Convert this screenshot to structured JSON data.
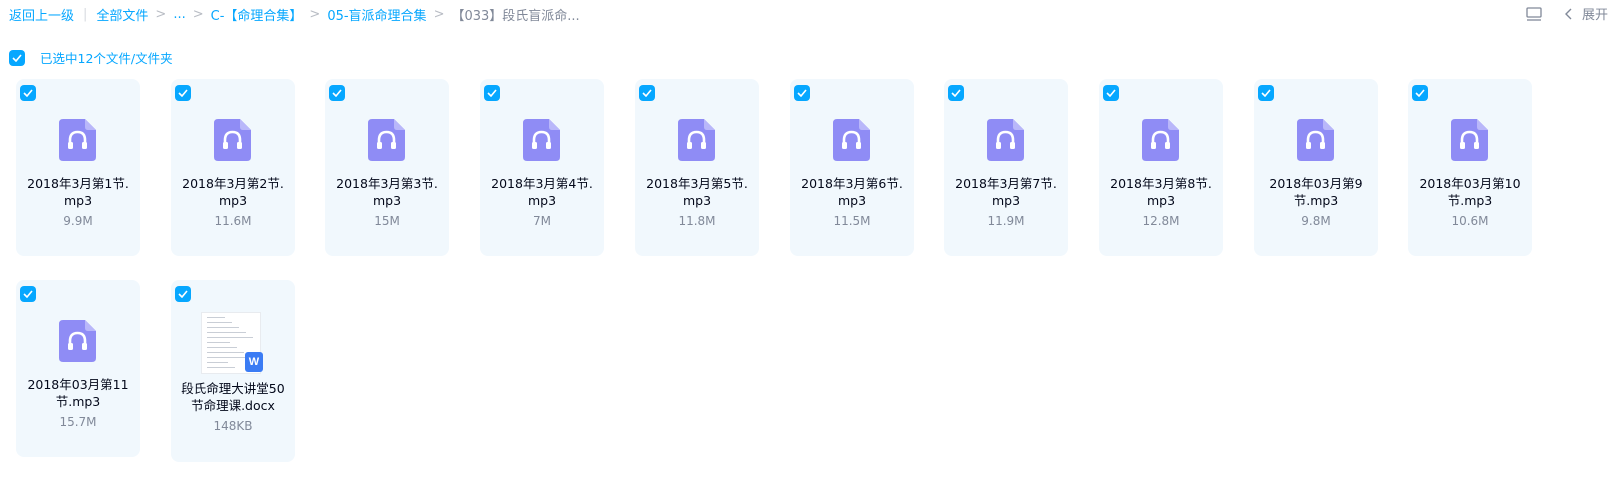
{
  "breadcrumb": {
    "back": "返回上一级",
    "all_files": "全部文件",
    "ellipsis": "...",
    "level1": "C-【命理合集】",
    "level2": "05-盲派命理合集",
    "current": "【033】段氏盲派命..."
  },
  "toolbar": {
    "expand_label": "展开"
  },
  "selection": {
    "label": "已选中12个文件/文件夹",
    "checked": true
  },
  "files": [
    {
      "name": "2018年3月第1节.mp3",
      "size": "9.9M",
      "type": "audio",
      "checked": true
    },
    {
      "name": "2018年3月第2节.mp3",
      "size": "11.6M",
      "type": "audio",
      "checked": true
    },
    {
      "name": "2018年3月第3节.mp3",
      "size": "15M",
      "type": "audio",
      "checked": true
    },
    {
      "name": "2018年3月第4节.mp3",
      "size": "7M",
      "type": "audio",
      "checked": true
    },
    {
      "name": "2018年3月第5节.mp3",
      "size": "11.8M",
      "type": "audio",
      "checked": true
    },
    {
      "name": "2018年3月第6节.mp3",
      "size": "11.5M",
      "type": "audio",
      "checked": true
    },
    {
      "name": "2018年3月第7节.mp3",
      "size": "11.9M",
      "type": "audio",
      "checked": true
    },
    {
      "name": "2018年3月第8节.mp3",
      "size": "12.8M",
      "type": "audio",
      "checked": true
    },
    {
      "name": "2018年03月第9节.mp3",
      "size": "9.8M",
      "type": "audio",
      "checked": true
    },
    {
      "name": "2018年03月第10节.mp3",
      "size": "10.6M",
      "type": "audio",
      "checked": true
    },
    {
      "name": "2018年03月第11节.mp3",
      "size": "15.7M",
      "type": "audio",
      "checked": true
    },
    {
      "name": "段氏命理大讲堂50节命理课.docx",
      "size": "148KB",
      "type": "doc",
      "checked": true
    }
  ],
  "colors": {
    "accent": "#06a7ff",
    "audio_icon": "#8f8cf5",
    "word_badge": "#3b7cf4",
    "card_bg": "#f1f8fd"
  }
}
